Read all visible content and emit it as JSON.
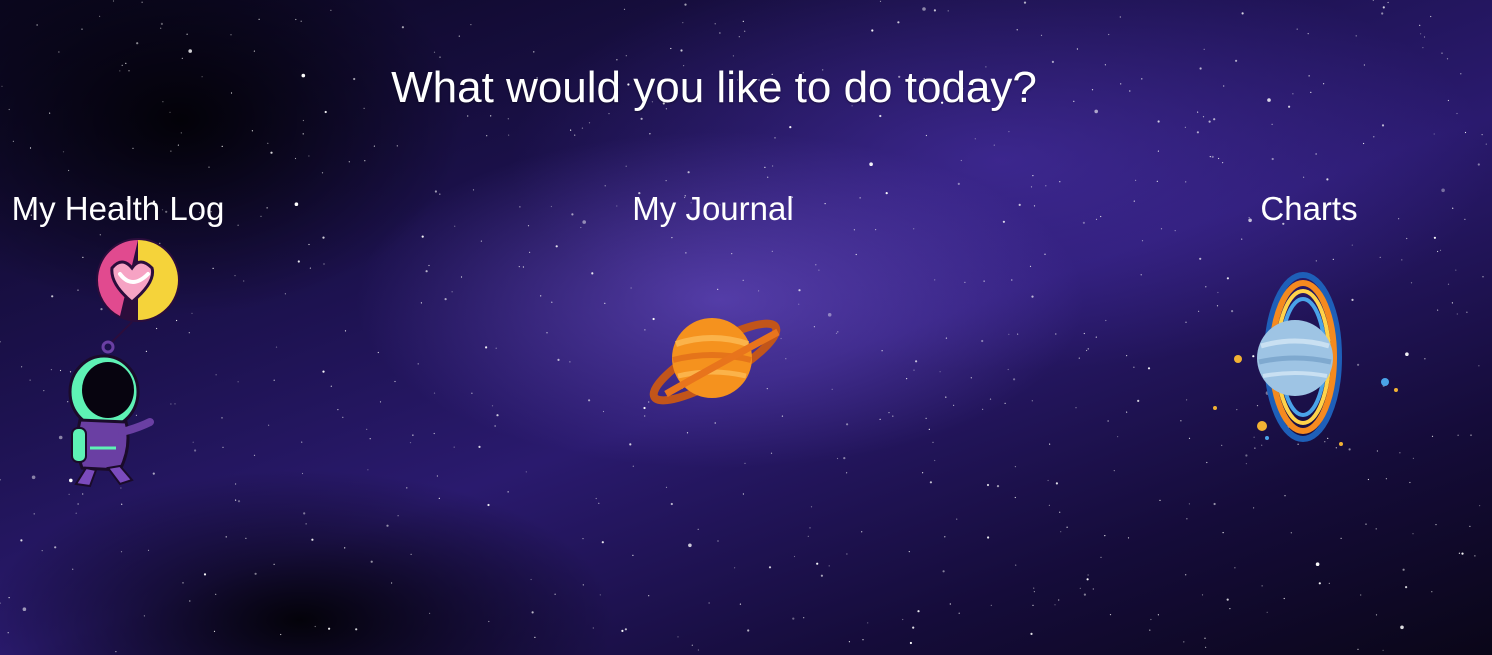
{
  "page": {
    "heading": "What would you like to do today?"
  },
  "options": [
    {
      "id": "health",
      "label": "My Health Log",
      "icon": "astronaut-heart-balloon-icon"
    },
    {
      "id": "journal",
      "label": "My Journal",
      "icon": "saturn-planet-icon"
    },
    {
      "id": "charts",
      "label": "Charts",
      "icon": "ringed-planet-icon"
    }
  ],
  "colors": {
    "text": "#ffffff",
    "background_dark": "#0b0720",
    "background_nebula": "#2a1a6e",
    "accent_orange": "#f5921e",
    "accent_mint": "#5ef2b5",
    "accent_purple": "#6a3fa3"
  }
}
